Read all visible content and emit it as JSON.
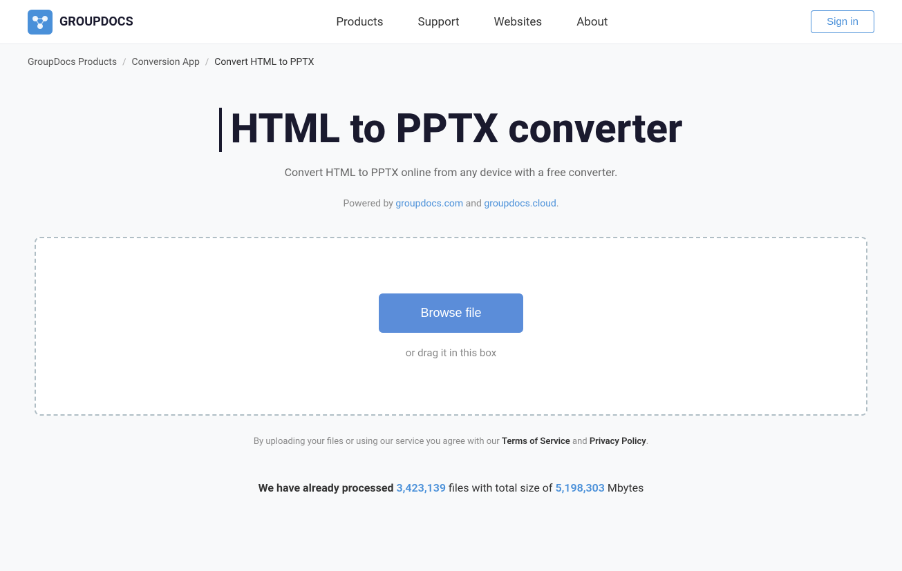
{
  "header": {
    "logo_text": "GROUPDOCS",
    "nav": {
      "items": [
        {
          "label": "Products",
          "id": "products"
        },
        {
          "label": "Support",
          "id": "support"
        },
        {
          "label": "Websites",
          "id": "websites"
        },
        {
          "label": "About",
          "id": "about"
        }
      ],
      "sign_in": "Sign in"
    }
  },
  "breadcrumb": {
    "items": [
      {
        "label": "GroupDocs Products",
        "href": "#"
      },
      {
        "label": "Conversion App",
        "href": "#"
      },
      {
        "label": "Convert HTML to PPTX",
        "href": null
      }
    ]
  },
  "main": {
    "title": "HTML to PPTX converter",
    "subtitle": "Convert HTML to PPTX online from any device with a free converter.",
    "powered_by_prefix": "Powered by ",
    "powered_by_link1": "groupdocs.com",
    "powered_by_and": " and ",
    "powered_by_link2": "groupdocs.cloud",
    "powered_by_suffix": ".",
    "upload": {
      "browse_label": "Browse file",
      "drag_label": "or drag it in this box"
    },
    "tos": {
      "prefix": "By uploading your files or using our service you agree with our ",
      "tos_link": "Terms of Service",
      "middle": " and ",
      "policy_link": "Privacy Policy",
      "suffix": "."
    },
    "stats": {
      "prefix": "We have already processed ",
      "files_count": "3,423,139",
      "middle": " files with total size of ",
      "size_count": "5,198,303",
      "suffix": " Mbytes"
    }
  }
}
